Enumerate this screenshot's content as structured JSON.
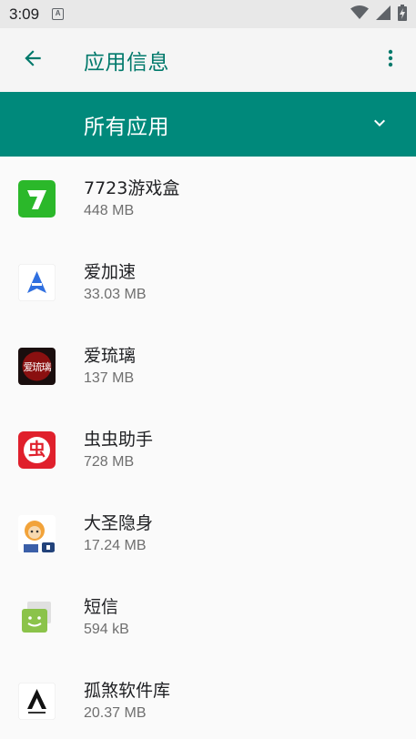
{
  "status_bar": {
    "time": "3:09",
    "notification_letter": "A",
    "icons": [
      "wifi-icon",
      "signal-icon",
      "battery-charging-icon"
    ]
  },
  "app_bar": {
    "title": "应用信息",
    "back_icon": "arrow-back-icon",
    "menu_icon": "more-vert-icon",
    "accent": "#00796b"
  },
  "filter": {
    "label": "所有应用",
    "chevron_icon": "chevron-down-icon",
    "background": "#00897b"
  },
  "apps": [
    {
      "name": "7723游戏盒",
      "size": "448 MB",
      "icon": "app-7723-icon"
    },
    {
      "name": "爱加速",
      "size": "33.03 MB",
      "icon": "app-aijiasu-icon"
    },
    {
      "name": "爱琉璃",
      "size": "137 MB",
      "icon": "app-ailiuli-icon",
      "icon_text": "爱琉璃"
    },
    {
      "name": "虫虫助手",
      "size": "728 MB",
      "icon": "app-chongchong-icon",
      "icon_text": "虫"
    },
    {
      "name": "大圣隐身",
      "size": "17.24 MB",
      "icon": "app-dasheng-icon"
    },
    {
      "name": "短信",
      "size": "594 kB",
      "icon": "app-messages-icon"
    },
    {
      "name": "孤煞软件库",
      "size": "20.37 MB",
      "icon": "app-gusha-icon"
    }
  ]
}
